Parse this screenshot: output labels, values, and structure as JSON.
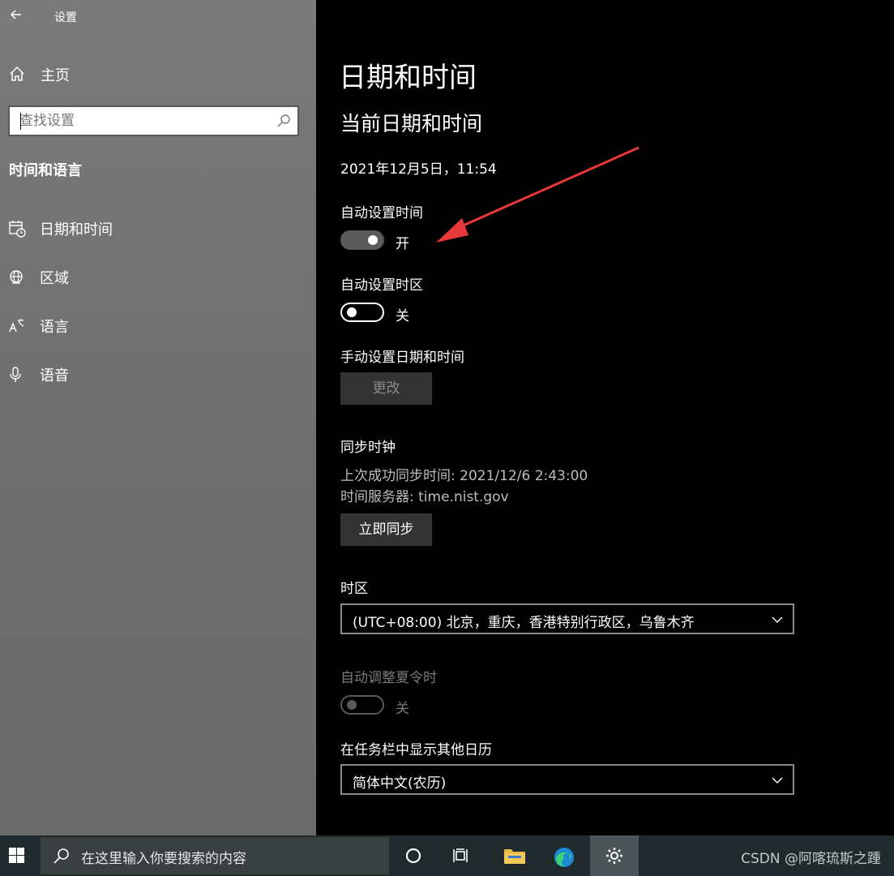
{
  "window": {
    "title": "设置"
  },
  "sidebar": {
    "home_label": "主页",
    "search_placeholder": "查找设置",
    "section_title": "时间和语言",
    "items": [
      {
        "label": "日期和时间",
        "icon": "calendar-clock-icon"
      },
      {
        "label": "区域",
        "icon": "globe-icon"
      },
      {
        "label": "语言",
        "icon": "language-icon"
      },
      {
        "label": "语音",
        "icon": "microphone-icon"
      }
    ]
  },
  "main": {
    "title": "日期和时间",
    "subtitle": "当前日期和时间",
    "current_datetime": "2021年12月5日，11:54",
    "auto_time": {
      "label": "自动设置时间",
      "state": "开"
    },
    "auto_timezone": {
      "label": "自动设置时区",
      "state": "关"
    },
    "manual": {
      "label": "手动设置日期和时间",
      "button": "更改"
    },
    "sync": {
      "label": "同步时钟",
      "last_sync": "上次成功同步时间: 2021/12/6 2:43:00",
      "server": "时间服务器: time.nist.gov",
      "button": "立即同步"
    },
    "timezone": {
      "label": "时区",
      "value": "(UTC+08:00) 北京，重庆，香港特别行政区，乌鲁木齐"
    },
    "dst": {
      "label": "自动调整夏令时",
      "state": "关"
    },
    "calendar": {
      "label": "在任务栏中显示其他日历",
      "value": "简体中文(农历)"
    }
  },
  "taskbar": {
    "search_text": "在这里输入你要搜索的内容",
    "watermark": "CSDN @阿喀琉斯之踵"
  },
  "colors": {
    "annotation_arrow": "#e8393a",
    "taskbar": "#202a2c"
  }
}
